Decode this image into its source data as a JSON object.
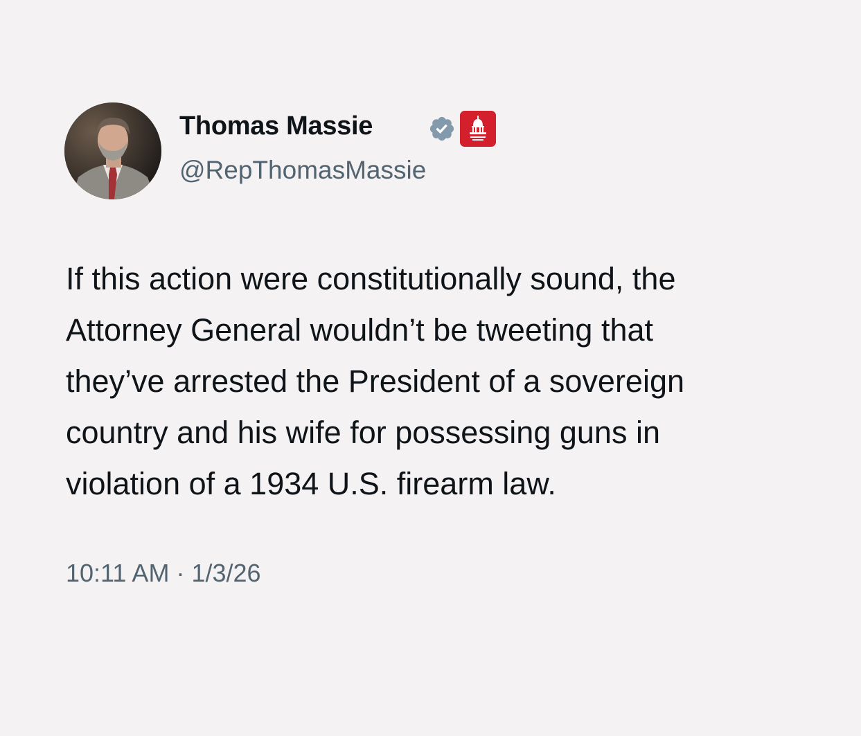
{
  "author": {
    "name": "Thomas Massie",
    "handle": "@RepThomasMassie",
    "verified_icon": "verified-badge-icon",
    "affiliation_icon": "us-capitol-badge-icon",
    "colors": {
      "verified": "#829aab",
      "affiliation": "#d4202d"
    }
  },
  "tweet": {
    "lines": [
      "If this action were constitutionally sound, the",
      "Attorney General wouldn’t be tweeting that",
      "they’ve arrested the President of a sovereign",
      "country and his wife for possessing guns in",
      "violation of a 1934 U.S. firearm law."
    ],
    "time": "10:11 AM",
    "separator": "·",
    "date": "1/3/26"
  }
}
